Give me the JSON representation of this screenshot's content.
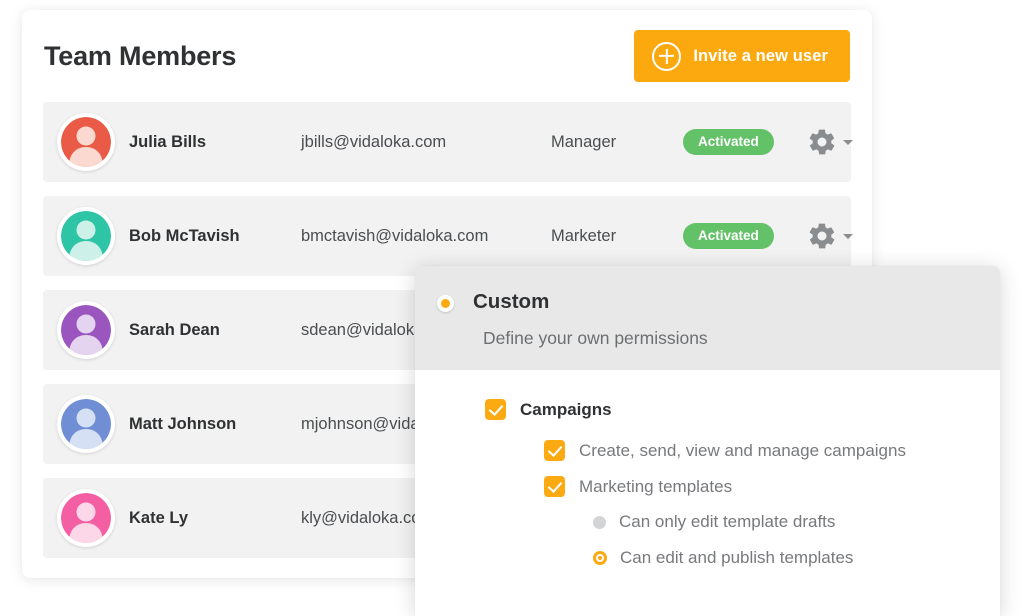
{
  "card": {
    "title": "Team Members",
    "invite_button": {
      "label": "Invite a new user",
      "icon": "plus-circle-icon",
      "color": "#fca90f"
    }
  },
  "members": [
    {
      "name": "Julia Bills",
      "email": "jbills@vidaloka.com",
      "role": "Manager",
      "status": "Activated",
      "status_color": "#63c168",
      "avatar_color": "#ea5b47",
      "avatar_fill": "#fbd8d0"
    },
    {
      "name": "Bob McTavish",
      "email": "bmctavish@vidaloka.com",
      "role": "Marketer",
      "status": "Activated",
      "status_color": "#63c168",
      "avatar_color": "#2ec4a6",
      "avatar_fill": "#cdf1e8"
    },
    {
      "name": "Sarah Dean",
      "email": "sdean@vidaloka.com",
      "role": "",
      "status": "",
      "status_color": "#63c168",
      "avatar_color": "#9a56be",
      "avatar_fill": "#e5d4f0"
    },
    {
      "name": "Matt Johnson",
      "email": "mjohnson@vidaloka.com",
      "role": "",
      "status": "",
      "status_color": "#63c168",
      "avatar_color": "#6f8ed4",
      "avatar_fill": "#d6e0f5"
    },
    {
      "name": "Kate Ly",
      "email": "kly@vidaloka.com",
      "role": "",
      "status": "",
      "status_color": "#63c168",
      "avatar_color": "#f45fa4",
      "avatar_fill": "#fcd7e8"
    }
  ],
  "permissions_panel": {
    "option": {
      "title": "Custom",
      "description": "Define your own permissions",
      "selected": true
    },
    "groups": [
      {
        "label": "Campaigns",
        "checked": true,
        "items": [
          {
            "label": "Create, send, view and manage campaigns",
            "checked": true
          },
          {
            "label": "Marketing templates",
            "checked": true
          }
        ]
      }
    ],
    "radio_options": [
      {
        "label": "Can only edit template drafts",
        "selected": false
      },
      {
        "label": "Can edit and publish templates",
        "selected": true
      }
    ],
    "accent_color": "#fcaa12"
  }
}
